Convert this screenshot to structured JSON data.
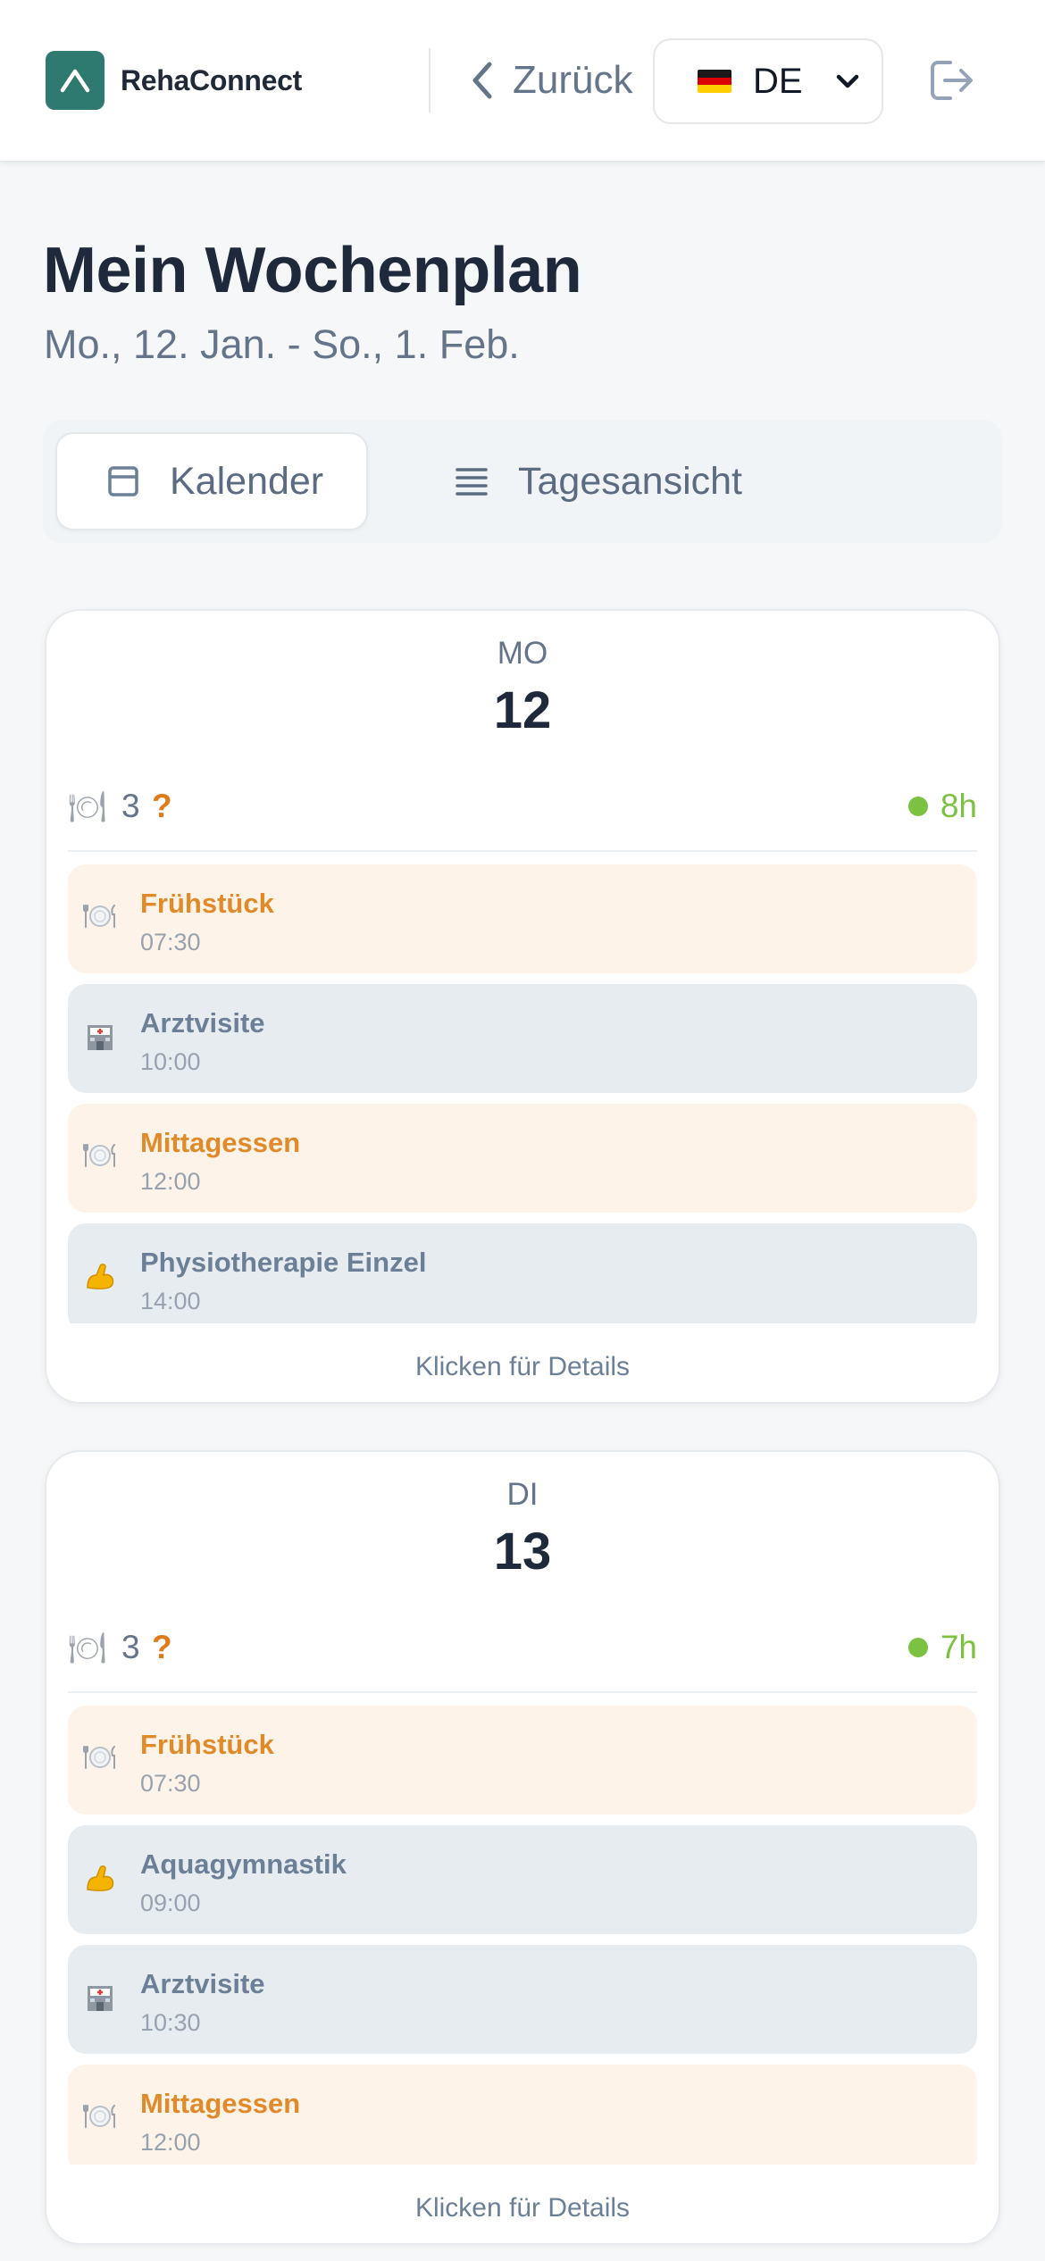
{
  "header": {
    "brand": "RehaConnect",
    "back_label": "Zurück",
    "language_code": "DE",
    "brand_color": "#2f7a70"
  },
  "page": {
    "title": "Mein Wochenplan",
    "date_range": "Mo., 12. Jan. - So., 1. Feb."
  },
  "view_toggle": {
    "calendar_label": "Kalender",
    "day_view_label": "Tagesansicht",
    "active": "calendar"
  },
  "days": [
    {
      "abbr": "MO",
      "num": "12",
      "meal_count": "3",
      "meal_flag": "?",
      "hours": "8h",
      "details_label": "Klicken für Details",
      "events": [
        {
          "title": "Frühstück",
          "time": "07:30",
          "kind": "meal",
          "icon": "plate-icon"
        },
        {
          "title": "Arztvisite",
          "time": "10:00",
          "kind": "therapy",
          "icon": "hospital-icon"
        },
        {
          "title": "Mittagessen",
          "time": "12:00",
          "kind": "meal",
          "icon": "plate-icon"
        },
        {
          "title": "Physiotherapie Einzel",
          "time": "14:00",
          "kind": "therapy",
          "icon": "muscle-icon"
        }
      ]
    },
    {
      "abbr": "DI",
      "num": "13",
      "meal_count": "3",
      "meal_flag": "?",
      "hours": "7h",
      "details_label": "Klicken für Details",
      "events": [
        {
          "title": "Frühstück",
          "time": "07:30",
          "kind": "meal",
          "icon": "plate-icon"
        },
        {
          "title": "Aquagymnastik",
          "time": "09:00",
          "kind": "therapy",
          "icon": "muscle-icon"
        },
        {
          "title": "Arztvisite",
          "time": "10:30",
          "kind": "therapy",
          "icon": "hospital-icon"
        },
        {
          "title": "Mittagessen",
          "time": "12:00",
          "kind": "meal",
          "icon": "plate-icon"
        }
      ]
    }
  ]
}
